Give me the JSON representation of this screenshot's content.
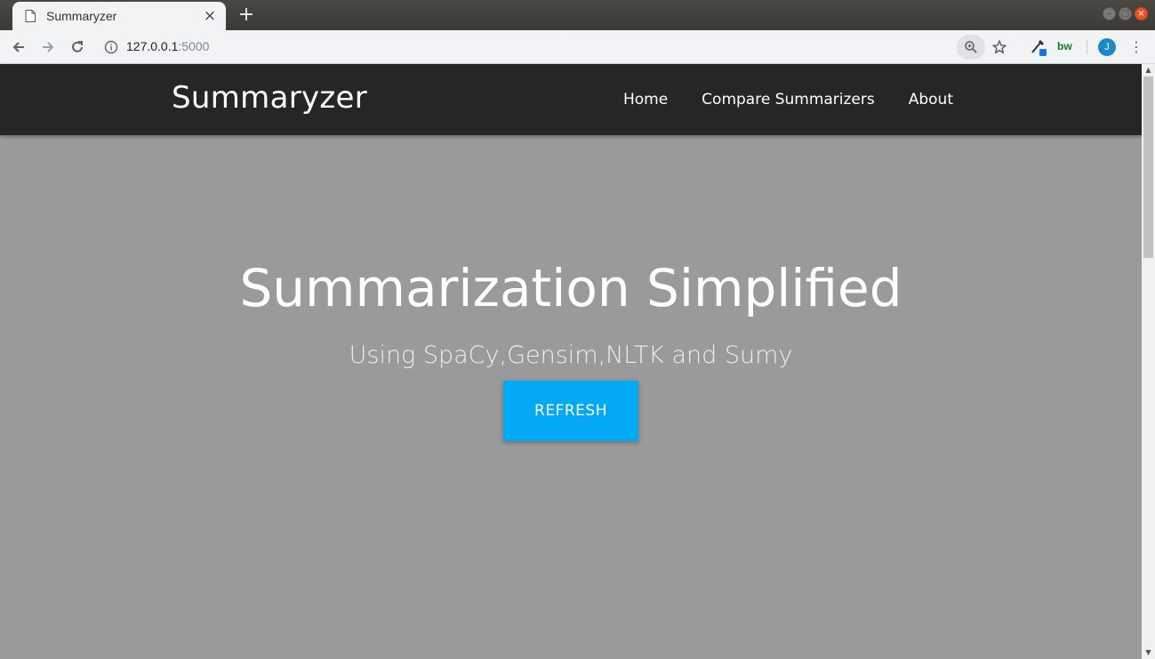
{
  "browser": {
    "tab_title": "Summaryzer",
    "tab_close": "×",
    "new_tab": "+",
    "url_host": "127.0.0.1",
    "url_port": ":5000",
    "extension_label": "bw",
    "profile_initial": "J",
    "menu": "⋮",
    "icons": [
      "back-arrow-icon",
      "forward-arrow-icon",
      "reload-icon",
      "info-icon",
      "zoom-icon",
      "star-icon",
      "eyedropper-icon",
      "menu-icon"
    ]
  },
  "navbar": {
    "brand": "Summaryzer",
    "links": [
      "Home",
      "Compare Summarizers",
      "About"
    ]
  },
  "hero": {
    "title": "Summarization Simplified",
    "subtitle": "Using SpaCy,Gensim,NLTK and Sumy",
    "button": "REFRESH"
  },
  "colors": {
    "navbar_bg": "#262626",
    "page_bg": "#9a9a9a",
    "accent": "#03a9f4"
  }
}
